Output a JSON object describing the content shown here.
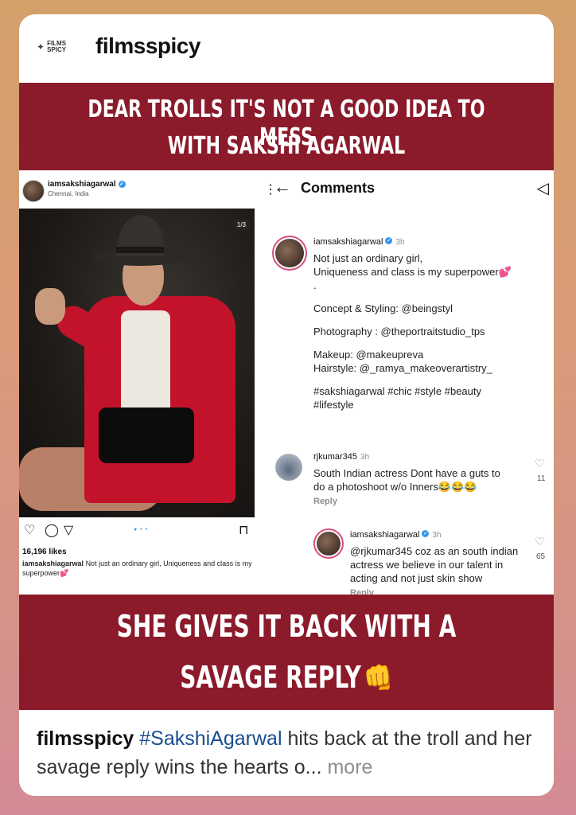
{
  "header": {
    "logo_text_1": "FILMS",
    "logo_text_2": "SPICY",
    "username": "filmsspicy"
  },
  "banner_top": {
    "line1": "DEAR TROLLS IT'S NOT A GOOD IDEA TO MESS",
    "line2": "WITH SAKSHI AGARWAL"
  },
  "post": {
    "username": "iamsakshiagarwal",
    "location": "Chennai, India",
    "counter": "1/3",
    "likes": "16,196 likes",
    "caption_user": "iamsakshiagarwal",
    "caption_text": "Not just an ordinary girl, Uniqueness and class is my superpower💕"
  },
  "comments": {
    "title": "Comments",
    "main": {
      "user": "iamsakshiagarwal",
      "time": "3h",
      "lines": [
        "Not just an ordinary girl,",
        "Uniqueness and class is my superpower💕",
        ".",
        "Concept & Styling: @beingstyl",
        "Photography : @theportraitstudio_tps",
        "Makeup: @makeupreva",
        "Hairstyle: @_ramya_makeoverartistry_",
        "#sakshiagarwal #chic #style #beauty",
        "#lifestyle"
      ]
    },
    "troll": {
      "user": "rjkumar345",
      "time": "3h",
      "line1": "South Indian actress Dont have a guts to",
      "line2": "do a photoshoot w/o Inners😂😂😂",
      "reply": "Reply",
      "likes": "11"
    },
    "answer": {
      "user": "iamsakshiagarwal",
      "time": "3h",
      "line1": "@rjkumar345 coz as an south indian",
      "line2": "actress we believe in our talent in",
      "line3": "acting and not just skin show",
      "reply": "Reply",
      "likes": "65"
    }
  },
  "banner_bottom": {
    "line1": "SHE GIVES IT BACK WITH A",
    "line2": "SAVAGE REPLY",
    "emoji": "👊"
  },
  "footer": {
    "username": "filmsspicy",
    "hashtag": "#SakshiAgarwal",
    "text": " hits back at the troll and her savage reply wins the hearts o...",
    "more": " more"
  },
  "colors": {
    "banner": "#8b1a2b",
    "verified": "#3897f0",
    "story_ring": "#d64d7f"
  }
}
